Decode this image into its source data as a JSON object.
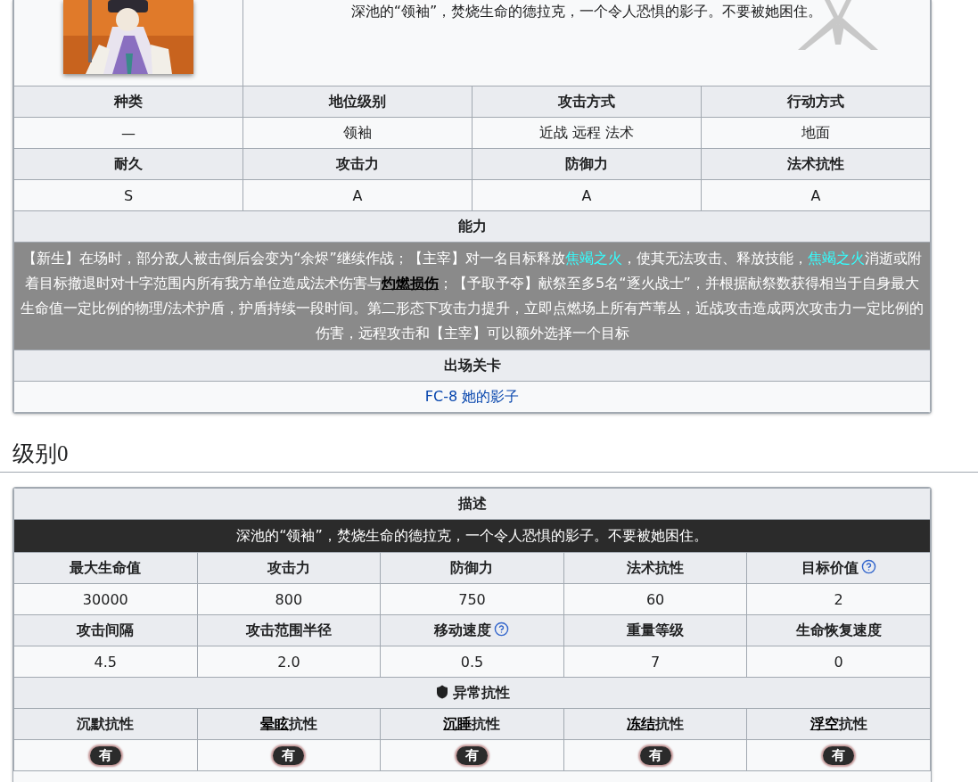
{
  "enemy_card": {
    "description": "深池的“领袖”，焚烧生命的德拉克，一个令人恐惧的影子。不要被她困住。",
    "rows": [
      {
        "kind": "header",
        "cells": [
          "种类",
          "地位级别",
          "攻击方式",
          "行动方式"
        ]
      },
      {
        "kind": "value",
        "cells": [
          "—",
          "领袖",
          "近战 远程 法术",
          "地面"
        ]
      },
      {
        "kind": "header",
        "cells": [
          "耐久",
          "攻击力",
          "防御力",
          "法术抗性"
        ]
      },
      {
        "kind": "value",
        "cells": [
          "S",
          "A",
          "A",
          "A"
        ]
      }
    ],
    "ability_title": "能力",
    "ability": [
      {
        "kind": "plain",
        "text": "【新生】在场时，部分敌人被击倒后会变为“余烬”继续作战；【主宰】对一名目标释放"
      },
      {
        "kind": "link",
        "text": "焦竭之火"
      },
      {
        "kind": "plain",
        "text": "，使其无法攻击、释放技能，"
      },
      {
        "kind": "link",
        "text": "焦竭之火"
      },
      {
        "kind": "plain",
        "text": "消逝或附着目标撤退时对十字范围内所有我方单位造成法术伤害与"
      },
      {
        "kind": "term",
        "text": "灼燃损伤"
      },
      {
        "kind": "plain",
        "text": "；【予取予夺】献祭至多5名“逐火战士”，并根据献祭数获得相当于自身最大生命值一定比例的物理/法术护盾，护盾持续一段时间。第二形态下攻击力提升，立即点燃场上所有芦苇丛，近战攻击造成两次攻击力一定比例的伤害，远程攻击和【主宰】可以额外选择一个目标"
      }
    ],
    "stage_title": "出场关卡",
    "stage_link": "FC-8 她的影子"
  },
  "level_heading": "级别0",
  "level_table": {
    "description_title": "描述",
    "description": "深池的“领袖”，焚烧生命的德拉克，一个令人恐惧的影子。不要被她困住。",
    "rows": [
      {
        "kind": "header",
        "cells": [
          {
            "text": "最大生命值",
            "help": false
          },
          {
            "text": "攻击力",
            "help": false
          },
          {
            "text": "防御力",
            "help": false
          },
          {
            "text": "法术抗性",
            "help": false
          },
          {
            "text": "目标价值",
            "help": true
          }
        ]
      },
      {
        "kind": "value",
        "cells": [
          {
            "text": "30000"
          },
          {
            "text": "800"
          },
          {
            "text": "750"
          },
          {
            "text": "60"
          },
          {
            "text": "2"
          }
        ]
      },
      {
        "kind": "header",
        "cells": [
          {
            "text": "攻击间隔",
            "help": false
          },
          {
            "text": "攻击范围半径",
            "help": false
          },
          {
            "text": "移动速度",
            "help": true
          },
          {
            "text": "重量等级",
            "help": false
          },
          {
            "text": "生命恢复速度",
            "help": false
          }
        ]
      },
      {
        "kind": "value",
        "cells": [
          {
            "text": "4.5"
          },
          {
            "text": "2.0"
          },
          {
            "text": "0.5"
          },
          {
            "text": "7"
          },
          {
            "text": "0"
          }
        ]
      }
    ],
    "resistance_title": "异常抗性",
    "resistance_headers": [
      {
        "term": "沉默",
        "suffix": "抗性",
        "linked": false
      },
      {
        "term": "晕眩",
        "suffix": "抗性",
        "linked": true
      },
      {
        "term": "沉睡",
        "suffix": "抗性",
        "linked": true
      },
      {
        "term": "冻结",
        "suffix": "抗性",
        "linked": true
      },
      {
        "term": "浮空",
        "suffix": "抗性",
        "linked": true
      }
    ],
    "resistance_values": [
      "有",
      "有",
      "有",
      "有",
      "有"
    ]
  }
}
